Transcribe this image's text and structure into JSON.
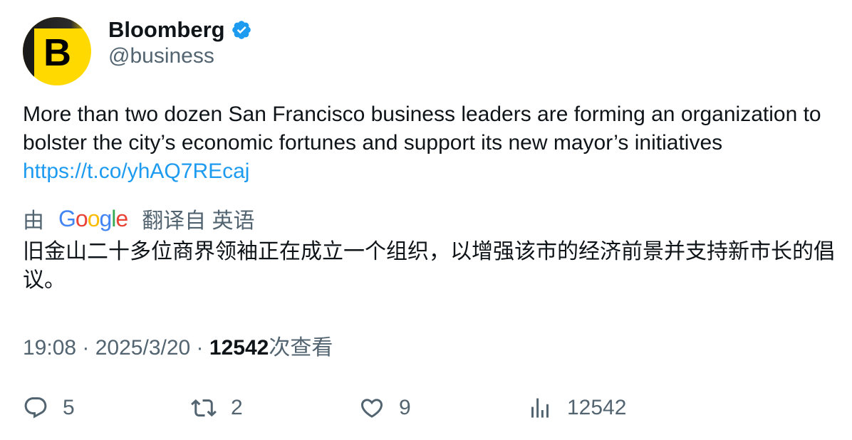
{
  "author": {
    "avatar_letter": "B",
    "display_name": "Bloomberg",
    "handle": "@business",
    "verified_icon": "verified-badge-icon"
  },
  "tweet": {
    "text": "More than two dozen San Francisco business leaders are forming an organization to bolster the city’s economic fortunes and support its new mayor’s initiatives ",
    "link": "https://t.co/yhAQ7REcaj"
  },
  "translation": {
    "prefix": "由",
    "google_letters": [
      "G",
      "o",
      "o",
      "g",
      "l",
      "e"
    ],
    "suffix": "翻译自 英语",
    "text": "旧金山二十多位商界领袖正在成立一个组织，以增强该市的经济前景并支持新市长的倡议。"
  },
  "meta": {
    "time": "19:08",
    "separator": " · ",
    "date": "2025/3/20",
    "views_count": "12542",
    "views_label": "次查看"
  },
  "actions": {
    "reply_count": "5",
    "retweet_count": "2",
    "like_count": "9",
    "views_count": "12542"
  },
  "colors": {
    "text": "#0f1419",
    "secondary": "#536471",
    "link": "#1d9bf0",
    "verified": "#1d9bf0",
    "bloomberg_yellow": "#ffd900"
  }
}
